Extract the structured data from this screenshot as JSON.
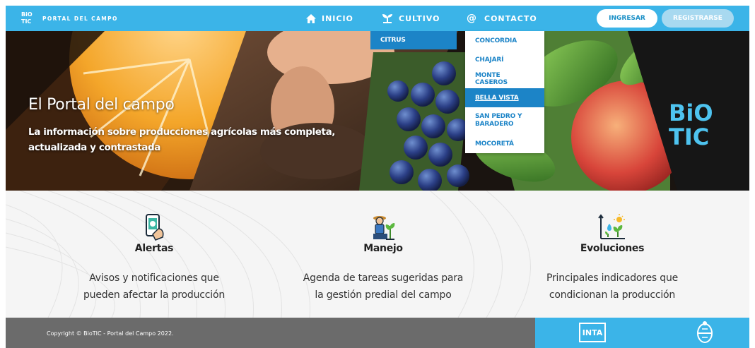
{
  "brand": {
    "logo_top": "BiO",
    "logo_bottom": "TIC",
    "name": "PORTAL DEL CAMPO"
  },
  "nav": {
    "items": [
      {
        "label": "INICIO",
        "icon": "home-icon"
      },
      {
        "label": "CULTIVO",
        "icon": "sprout-icon"
      },
      {
        "label": "CONTACTO",
        "icon": "at-icon"
      }
    ],
    "login_label": "INGRESAR",
    "register_label": "REGISTRARSE"
  },
  "cultivo_menu": {
    "items": [
      "CITRUS"
    ]
  },
  "contacto_menu": {
    "items": [
      "CONCORDIA",
      "CHAJARÍ",
      "MONTE CASEROS",
      "BELLA VISTA",
      "SAN PEDRO Y BARADERO",
      "MOCORETÁ"
    ],
    "active": "BELLA VISTA"
  },
  "hero": {
    "title": "El Portal del campo",
    "subtitle": "La información sobre producciones agrícolas más completa, actualizada y contrastada",
    "logo_top": "BiO",
    "logo_bottom": "TIC"
  },
  "features": [
    {
      "title": "Alertas",
      "description_1": "Avisos y notificaciones que",
      "description_2": "pueden afectar la producción",
      "icon": "phone-alert-icon"
    },
    {
      "title": "Manejo",
      "description_1": "Agenda de tareas sugeridas para",
      "description_2": "la gestión predial del campo",
      "icon": "farmer-icon"
    },
    {
      "title": "Evoluciones",
      "description_1": "Principales indicadores que",
      "description_2": "condicionan la producción",
      "icon": "growth-chart-icon"
    }
  ],
  "footer": {
    "copyright": "Copyright © BioTIC - Portal del Campo 2022.",
    "partner_logo": "INTA",
    "seal_icon": "national-seal-icon"
  },
  "colors": {
    "primary": "#3bb4e8",
    "dropdown": "#1c84c7",
    "footer": "#6b6b6b"
  }
}
